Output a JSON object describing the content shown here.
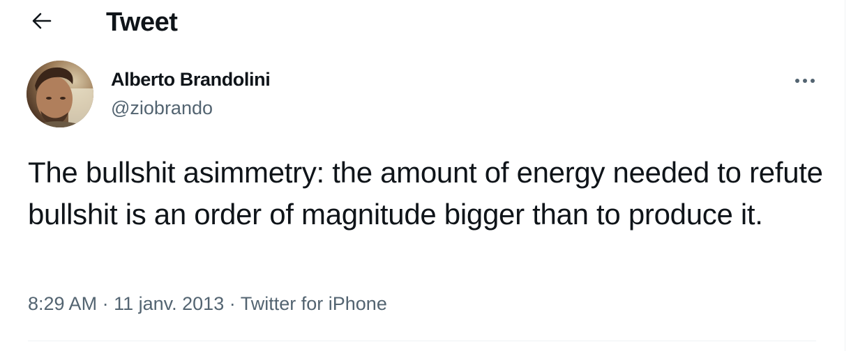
{
  "header": {
    "back_icon": "arrow-left-icon",
    "title": "Tweet"
  },
  "tweet": {
    "author": {
      "name": "Alberto Brandolini",
      "handle": "@ziobrando",
      "avatar_icon": "avatar-photo"
    },
    "more_icon": "more-horizontal-icon",
    "text": "The bullshit asimmetry: the amount of energy needed to refute bullshit is an order of magnitude bigger than to produce it.",
    "time": "8:29 AM",
    "separator": "·",
    "date": "11 janv. 2013",
    "source": "Twitter for iPhone"
  },
  "colors": {
    "text_primary": "#0f1419",
    "text_secondary": "#536471",
    "border": "#eff3f4",
    "background": "#ffffff"
  }
}
